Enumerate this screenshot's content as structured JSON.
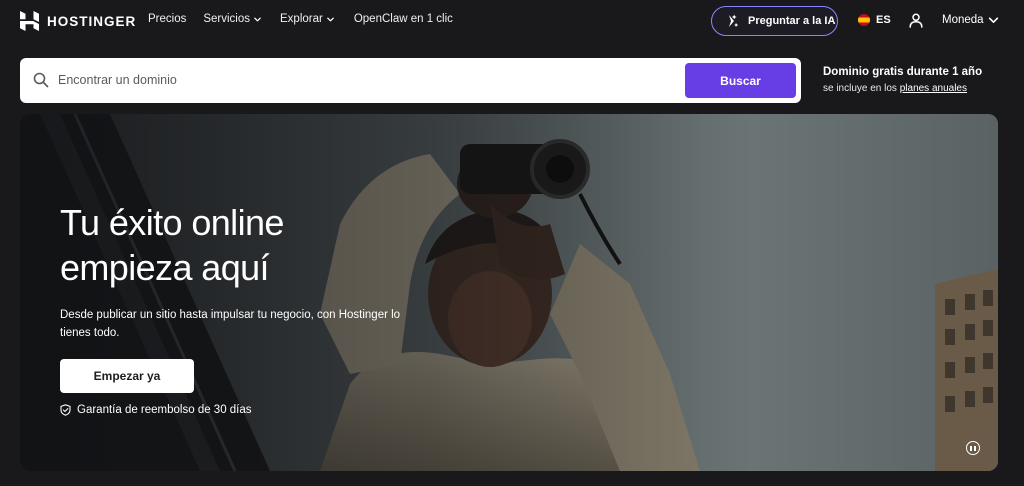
{
  "brand": {
    "name": "HOSTINGER",
    "accent_color": "#673de6",
    "ai_border_color": "#8c85ff"
  },
  "nav": {
    "links": [
      {
        "label": "Precios",
        "has_dropdown": false
      },
      {
        "label": "Servicios",
        "has_dropdown": true
      },
      {
        "label": "Explorar",
        "has_dropdown": true
      },
      {
        "label": "OpenClaw en 1 clic",
        "has_dropdown": false
      }
    ],
    "ai_button": {
      "label": "Preguntar a la IA",
      "icon": "sparkle-arrow-icon"
    },
    "language": {
      "code": "ES",
      "icon": "spain-flag-icon"
    },
    "account_icon": "user-icon",
    "currency": {
      "label": "Moneda",
      "icon": "chevron-down-icon"
    }
  },
  "domain_search": {
    "placeholder": "Encontrar un dominio",
    "value": "",
    "button_label": "Buscar",
    "icon": "search-icon"
  },
  "promo": {
    "title": "Dominio gratis durante 1 año",
    "subtitle_prefix": "se incluye en los ",
    "subtitle_link": "planes anuales"
  },
  "hero": {
    "title_line1": "Tu éxito online",
    "title_line2": "empieza aquí",
    "description": "Desde publicar un sitio hasta impulsar tu negocio, con Hostinger lo tienes todo.",
    "cta_label": "Empezar ya",
    "guarantee": "Garantía de reembolso de 30 días",
    "guarantee_icon": "shield-check-icon",
    "video_control_icon": "pause-icon"
  }
}
